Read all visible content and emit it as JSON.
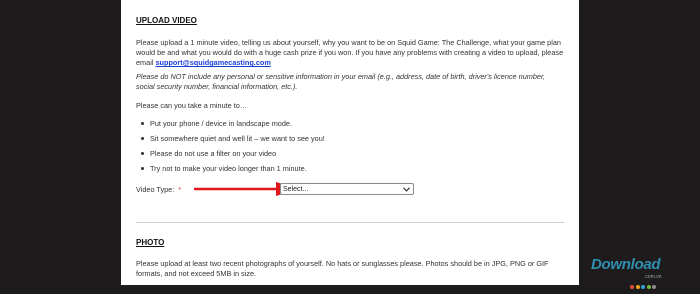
{
  "upload": {
    "heading": "UPLOAD VIDEO",
    "intro": "Please upload a 1 minute video, telling us about yourself, why you want to be on Squid Game: The Challenge, what your game plan would be and what you would do with a huge cash prize if you won. If you have any problems with creating a video to upload, please email ",
    "email": "support@squidgamecasting.com",
    "privacy_note": "Please do NOT include any personal or sensitive information in your email (e.g., address, date of birth, driver's licence number, social security number, financial information, etc.).",
    "prompt": "Please can you take a minute to…",
    "tips": [
      "Put your phone / device in landscape mode.",
      "Sit somewhere quiet and well lit – we want to see you!",
      "Please do not use a filter on your video",
      "Try not to make your video longer than 1 minute."
    ],
    "video_type_label": "Video Type:",
    "required_mark": "*",
    "video_type_value": "Select..."
  },
  "photo": {
    "heading": "PHOTO",
    "text": "Please upload at least two recent photographs of yourself. No hats or sunglasses please. Photos should be in JPG, PNG or GIF formats, and not exceed 5MB in size."
  },
  "watermark": {
    "text": "Download",
    "sub": ".com.vn"
  },
  "colors": {
    "arrow": "#e0161b",
    "link": "#1a3fd8",
    "backdrop": "#1e1b1c"
  }
}
